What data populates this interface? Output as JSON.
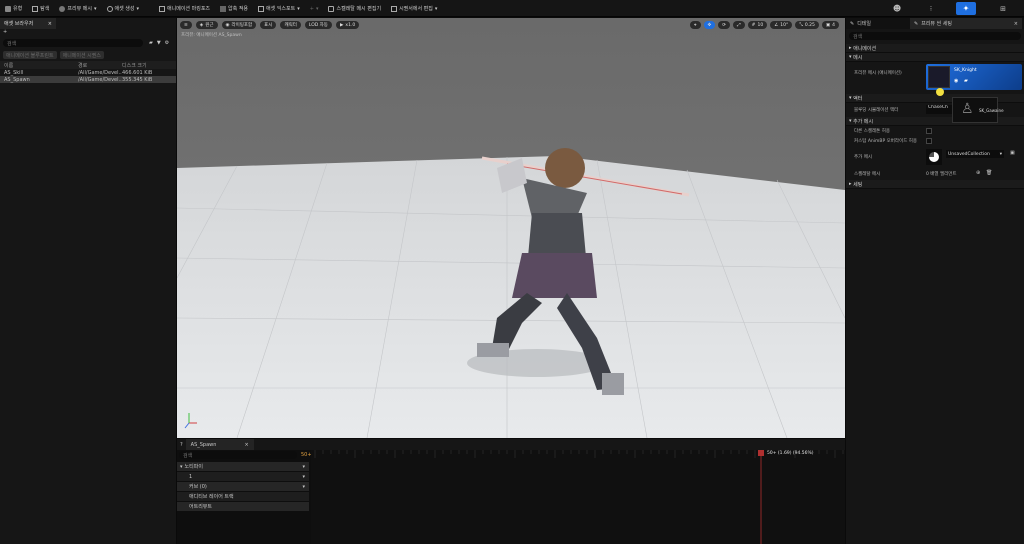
{
  "toolbar": {
    "items": [
      {
        "label": "유형",
        "icon": "save-icon"
      },
      {
        "label": "탐색",
        "icon": "browse-icon"
      },
      {
        "label": "프리뷰 메시",
        "icon": "mesh-icon"
      },
      {
        "label": "애셋 생성",
        "icon": "create-icon"
      },
      {
        "label": "애니메이션 마킹포즈",
        "icon": "animation-icon"
      },
      {
        "label": "압축 적용",
        "icon": "compress-icon"
      },
      {
        "label": "애셋 익스포트",
        "icon": "export-icon"
      },
      {
        "label": "스켈레탈 메시 편집기",
        "icon": "skeleton-icon"
      },
      {
        "label": "시퀀서에서 편집",
        "icon": "sequencer-icon"
      }
    ],
    "accent": "#1f6fe0"
  },
  "left_panel": {
    "tab_title": "애셋 브라우저",
    "search_placeholder": "검색",
    "filter_pill_1": "애니메이션 블루프린트",
    "filter_pill_2": "애니메이션 시퀀스",
    "columns": [
      "이름",
      "경로",
      "디스크 크기"
    ],
    "rows": [
      {
        "name": "AS_Skill",
        "path": "/All/Game/Devel..",
        "size": "466.601 KiB",
        "selected": false
      },
      {
        "name": "AS_Spawn",
        "path": "/All/Game/Devel..",
        "size": "355.345 KiB",
        "selected": true
      }
    ]
  },
  "viewport": {
    "buttons": [
      "원근",
      "라이팅포함",
      "표시",
      "캐릭터",
      "LOD 자동",
      "x1.0"
    ],
    "info_text": "프리뷰: 애니메이션 AS_Spawn",
    "right_icons": [
      "perspective-icon",
      "select-icon",
      "translate-icon",
      "rotate-icon",
      "scale-icon",
      "grid-icon"
    ],
    "right_values": [
      "10",
      "10°",
      "0.25",
      "4"
    ]
  },
  "timeline": {
    "tab_label": "AS_Spawn",
    "search_placeholder": "검색",
    "frame_start": "50+",
    "playhead_label": "50+ (1.69) (94.56%)",
    "tracks": [
      {
        "label": "노티파이",
        "expanded": true
      },
      {
        "label": "1",
        "expanded": false
      },
      {
        "label": "커브 (0)",
        "expanded": false
      },
      {
        "label": "애디티브 레이어 트랙",
        "expanded": false
      },
      {
        "label": "어트리뷰트",
        "expanded": false
      }
    ]
  },
  "right_panel": {
    "tab_1": "디테일",
    "tab_2": "프리뷰 씬 세팅",
    "search_placeholder": "검색",
    "sections": {
      "animation": "애니메이션",
      "mesh": "메시",
      "mesh_label": "프리뷰 메시 (애니메이션)",
      "mesh_value": "SK_Knight",
      "actor": "액터",
      "actor_label": "블루딩 시뮬레이션 액터",
      "actor_value": "ChaseCh",
      "actor_thumb": "SK_Gawaine",
      "additional": "추가 메시",
      "check_1": "다른 스켈레톤 허용",
      "check_2": "커스텀 AnimBP 오버라이드 허용",
      "extra_mesh_label": "추가 메시",
      "extra_mesh_value": "UnsavedCollection",
      "skeleton_mesh_label": "스켈레탈 메시",
      "skeleton_mesh_value": "0 배열 엘리먼트",
      "settings": "세팅"
    }
  }
}
